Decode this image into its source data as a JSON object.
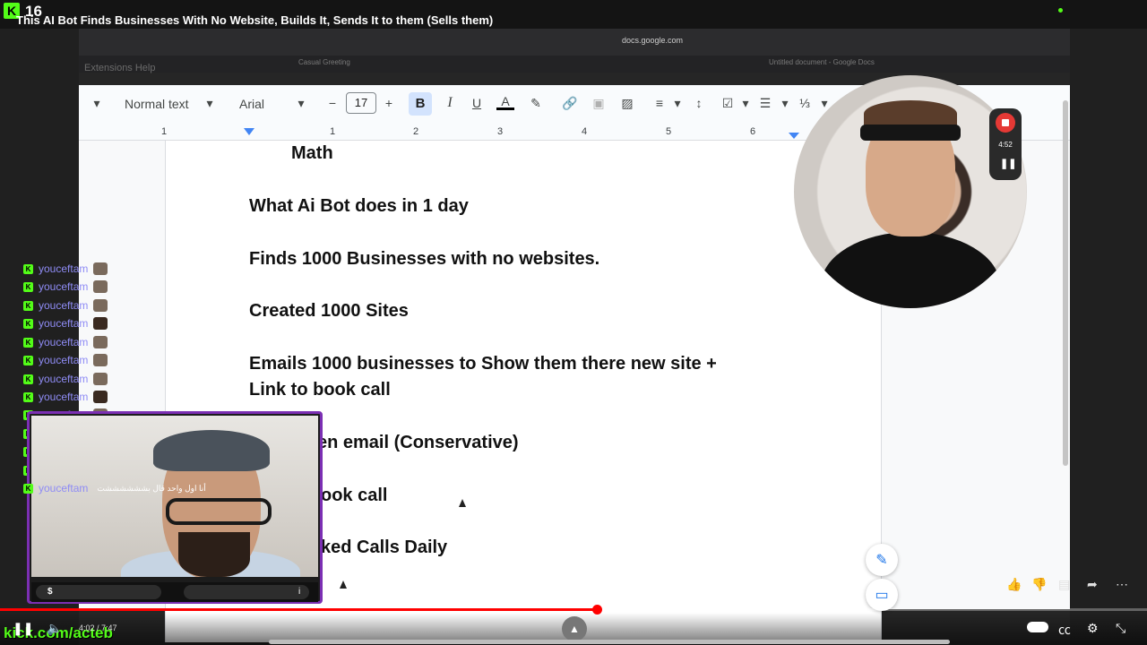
{
  "stream": {
    "viewer_count": "16",
    "title": "This AI Bot Finds Businesses With No Website, Builds It, Sends It to them (Sells them)",
    "channel_url": "kick.com/acteb"
  },
  "browser": {
    "url": "docs.google.com",
    "tabs": [
      "Casual Greeting",
      "Untitled document - Google Docs"
    ],
    "menu_fragment": "Extensions   Help"
  },
  "toolbar": {
    "style_label": "Normal text",
    "font_label": "Arial",
    "font_size": "17",
    "bold_label": "B",
    "italic_label": "I",
    "underline_label": "U",
    "text_color_label": "A"
  },
  "ruler": {
    "numbers": [
      "1",
      "1",
      "2",
      "3",
      "4",
      "5",
      "6"
    ]
  },
  "document": {
    "lines": [
      "Math",
      "What Ai Bot does in 1 day",
      "Finds 1000 Businesses with no websites.",
      "Created 1000 Sites",
      "Emails 1000 businesses to Show them there new site +",
      "Link to book call",
      "en email (Conservative)",
      "ook call",
      "ked Calls Daily"
    ]
  },
  "recorder": {
    "time": "4:52"
  },
  "chat": {
    "messages": [
      {
        "user": "youceftam",
        "text": ""
      },
      {
        "user": "youceftam",
        "text": ""
      },
      {
        "user": "youceftam",
        "text": ""
      },
      {
        "user": "youceftam",
        "text": ""
      },
      {
        "user": "youceftam",
        "text": ""
      },
      {
        "user": "youceftam",
        "text": ""
      },
      {
        "user": "youceftam",
        "text": ""
      },
      {
        "user": "youceftam",
        "text": ""
      },
      {
        "user": "youceftam",
        "text": ""
      },
      {
        "user": "youceftam",
        "text": ""
      },
      {
        "user": "youceftam",
        "text": ""
      },
      {
        "user": "youceftam",
        "text": ""
      },
      {
        "user": "youceftam",
        "text": "أنا اول واحد قال بششششششت"
      }
    ]
  },
  "streamer_bar": {
    "left_label": "$",
    "right_label": "i"
  },
  "player": {
    "time_text": "4:02 / 7:47",
    "progress": 0.52,
    "icons": [
      "like-icon",
      "dislike-icon",
      "comment-icon",
      "share-icon",
      "more-icon",
      "play-pause-icon",
      "mute-icon",
      "autoplay-toggle",
      "captions-icon",
      "settings-icon",
      "fullscreen-exit-icon"
    ]
  },
  "colors": {
    "kick_green": "#53fc18",
    "chat_user": "#8f8cf5",
    "progress_red": "#ff0000",
    "bold_active": "#d3e3fd",
    "frame_purple": "#7b2fb3"
  }
}
